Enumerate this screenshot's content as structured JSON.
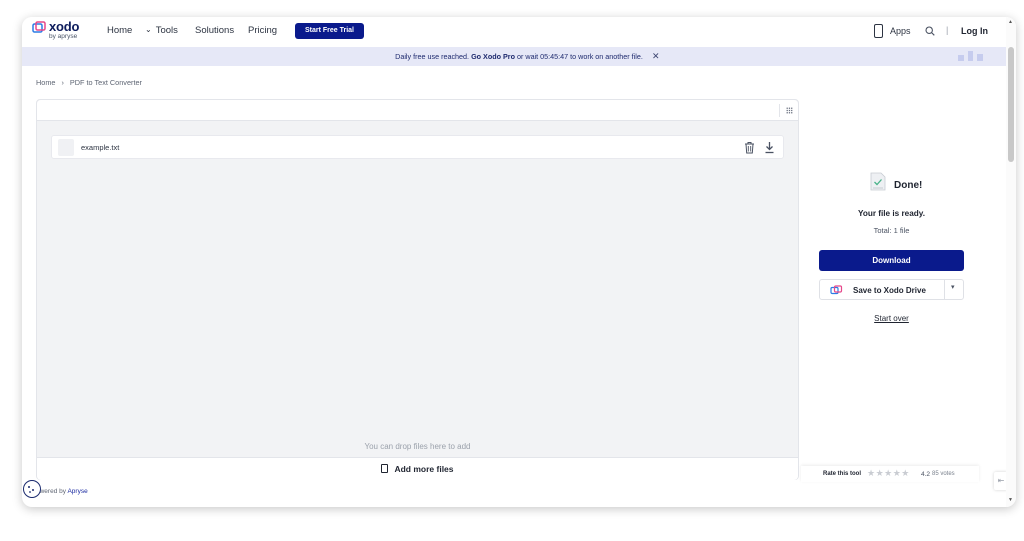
{
  "header": {
    "logo_name": "xodo",
    "logo_sub": "by apryse",
    "nav": {
      "home": "Home",
      "tools": "Tools",
      "solutions": "Solutions",
      "pricing": "Pricing"
    },
    "cta_label": "Start Free Trial",
    "apps_label": "Apps",
    "separator": "|",
    "login_label": "Log In"
  },
  "banner": {
    "prefix": "Daily free use reached.",
    "link": "Go Xodo Pro",
    "middle": "or wait",
    "timer": "05:45:47",
    "suffix": "to work on another file.",
    "close": "✕"
  },
  "breadcrumb": {
    "home": "Home",
    "arrow": "›",
    "current": "PDF to Text Converter"
  },
  "file_panel": {
    "files": [
      {
        "name": "example.txt"
      }
    ],
    "drop_hint": "You can drop files here to add",
    "add_more_label": "Add more files"
  },
  "result": {
    "title": "Done!",
    "ready_text": "Your file is ready.",
    "total_text": "Total: 1 file",
    "download_label": "Download",
    "drive_label": "Save to Xodo Drive",
    "drive_caret": "▾",
    "start_over_label": "Start over"
  },
  "rating": {
    "label": "Rate this tool",
    "stars": "★★★★★",
    "value": "4.2",
    "votes": "85 votes"
  },
  "footer": {
    "powered_prefix": "owered by",
    "powered_brand": "Apryse",
    "collapse": "⇤"
  },
  "colors": {
    "brand_blue": "#0a1a8c",
    "banner_bg": "#e6e8f7"
  }
}
